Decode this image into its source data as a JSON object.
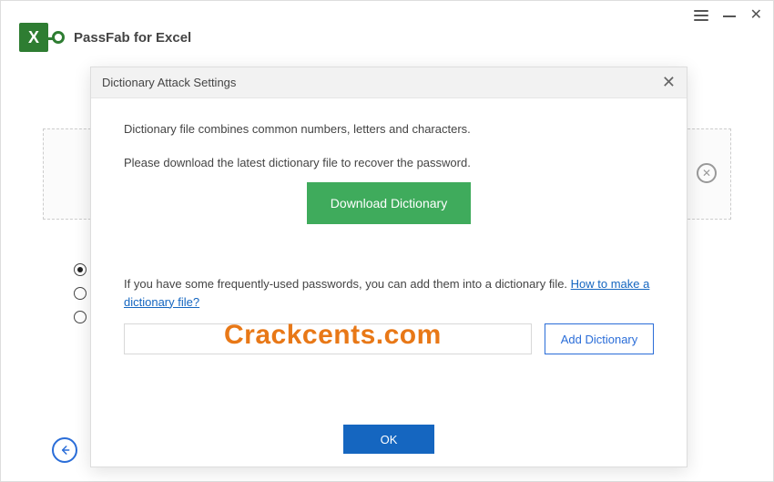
{
  "app": {
    "title": "PassFab for Excel",
    "logo_letter": "X"
  },
  "modal": {
    "title": "Dictionary Attack Settings",
    "line1": "Dictionary file combines common numbers, letters and characters.",
    "line2": "Please download the latest dictionary file to recover the password.",
    "download_label": "Download Dictionary",
    "freq_text": "If you have some frequently-used passwords, you can add them into a dictionary file. ",
    "link_text": "How to make a dictionary file?",
    "add_label": "Add Dictionary",
    "dict_path": "",
    "ok_label": "OK"
  },
  "watermark": "Crackcents.com"
}
